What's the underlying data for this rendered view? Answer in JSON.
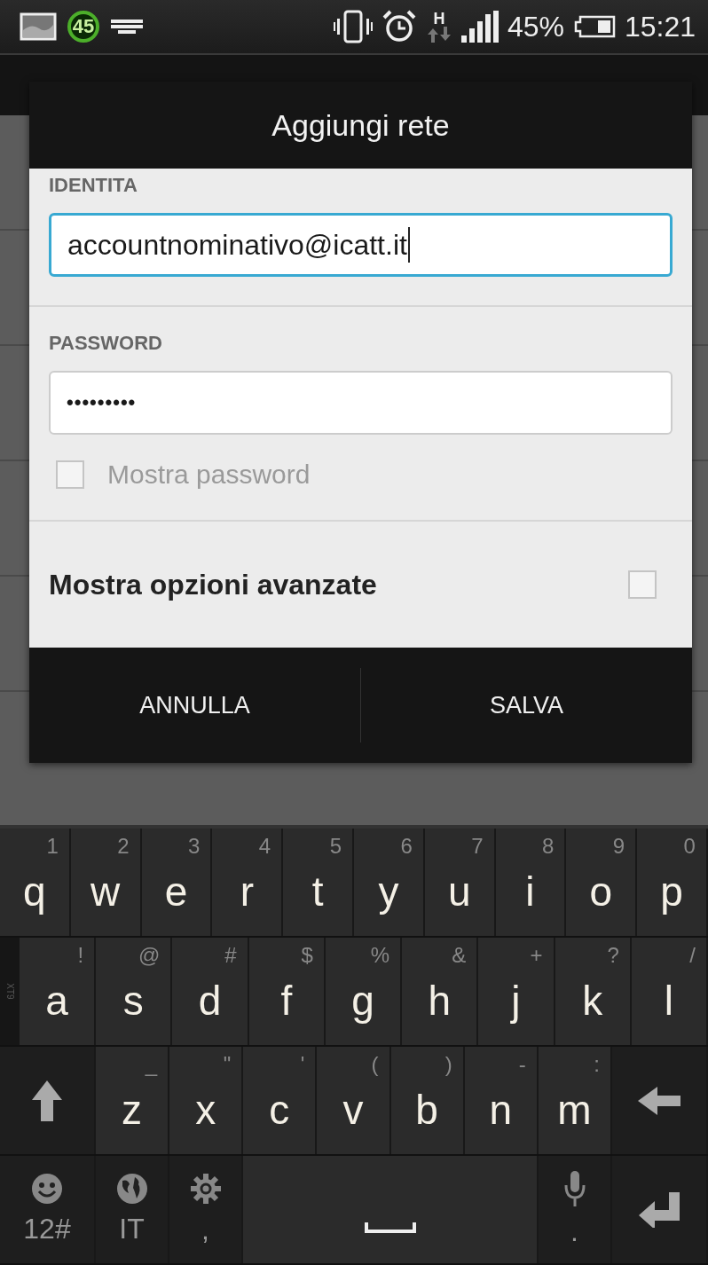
{
  "status_bar": {
    "notification_badge": "45",
    "network_type": "H",
    "battery_text": "45%",
    "time": "15:21"
  },
  "dialog": {
    "title": "Aggiungi rete",
    "fields": [
      {
        "label": "IDENTITA",
        "value": "accountnominativo@icatt.it",
        "focused": true
      },
      {
        "label": "PASSWORD",
        "value": "•••••••••",
        "focused": false
      }
    ],
    "show_password": {
      "label": "Mostra password",
      "checked": false
    },
    "advanced_options": {
      "label": "Mostra opzioni avanzate",
      "checked": false
    },
    "buttons": [
      "ANNULLA",
      "SALVA"
    ]
  },
  "keyboard": {
    "side_label": "XT9",
    "rows": [
      {
        "keys": [
          {
            "kind": "letter",
            "label": "q",
            "hint": "1"
          },
          {
            "kind": "letter",
            "label": "w",
            "hint": "2"
          },
          {
            "kind": "letter",
            "label": "e",
            "hint": "3"
          },
          {
            "kind": "letter",
            "label": "r",
            "hint": "4"
          },
          {
            "kind": "letter",
            "label": "t",
            "hint": "5"
          },
          {
            "kind": "letter",
            "label": "y",
            "hint": "6"
          },
          {
            "kind": "letter",
            "label": "u",
            "hint": "7"
          },
          {
            "kind": "letter",
            "label": "i",
            "hint": "8"
          },
          {
            "kind": "letter",
            "label": "o",
            "hint": "9"
          },
          {
            "kind": "letter",
            "label": "p",
            "hint": "0"
          }
        ]
      },
      {
        "keys": [
          {
            "kind": "letter",
            "label": "a",
            "hint": "!"
          },
          {
            "kind": "letter",
            "label": "s",
            "hint": "@"
          },
          {
            "kind": "letter",
            "label": "d",
            "hint": "#"
          },
          {
            "kind": "letter",
            "label": "f",
            "hint": "$"
          },
          {
            "kind": "letter",
            "label": "g",
            "hint": "%"
          },
          {
            "kind": "letter",
            "label": "h",
            "hint": "&"
          },
          {
            "kind": "letter",
            "label": "j",
            "hint": "+"
          },
          {
            "kind": "letter",
            "label": "k",
            "hint": "?"
          },
          {
            "kind": "letter",
            "label": "l",
            "hint": "/"
          }
        ]
      },
      {
        "keys": [
          {
            "kind": "shift"
          },
          {
            "kind": "letter",
            "label": "z",
            "hint": "_"
          },
          {
            "kind": "letter",
            "label": "x",
            "hint": "\""
          },
          {
            "kind": "letter",
            "label": "c",
            "hint": "'"
          },
          {
            "kind": "letter",
            "label": "v",
            "hint": "("
          },
          {
            "kind": "letter",
            "label": "b",
            "hint": ")"
          },
          {
            "kind": "letter",
            "label": "n",
            "hint": "-"
          },
          {
            "kind": "letter",
            "label": "m",
            "hint": ":"
          },
          {
            "kind": "backspace"
          }
        ]
      },
      {
        "keys": [
          {
            "kind": "emoji",
            "label": "12#"
          },
          {
            "kind": "language",
            "label": "IT"
          },
          {
            "kind": "settings",
            "label": ","
          },
          {
            "kind": "space"
          },
          {
            "kind": "voice",
            "label": "."
          },
          {
            "kind": "enter"
          }
        ]
      }
    ]
  }
}
